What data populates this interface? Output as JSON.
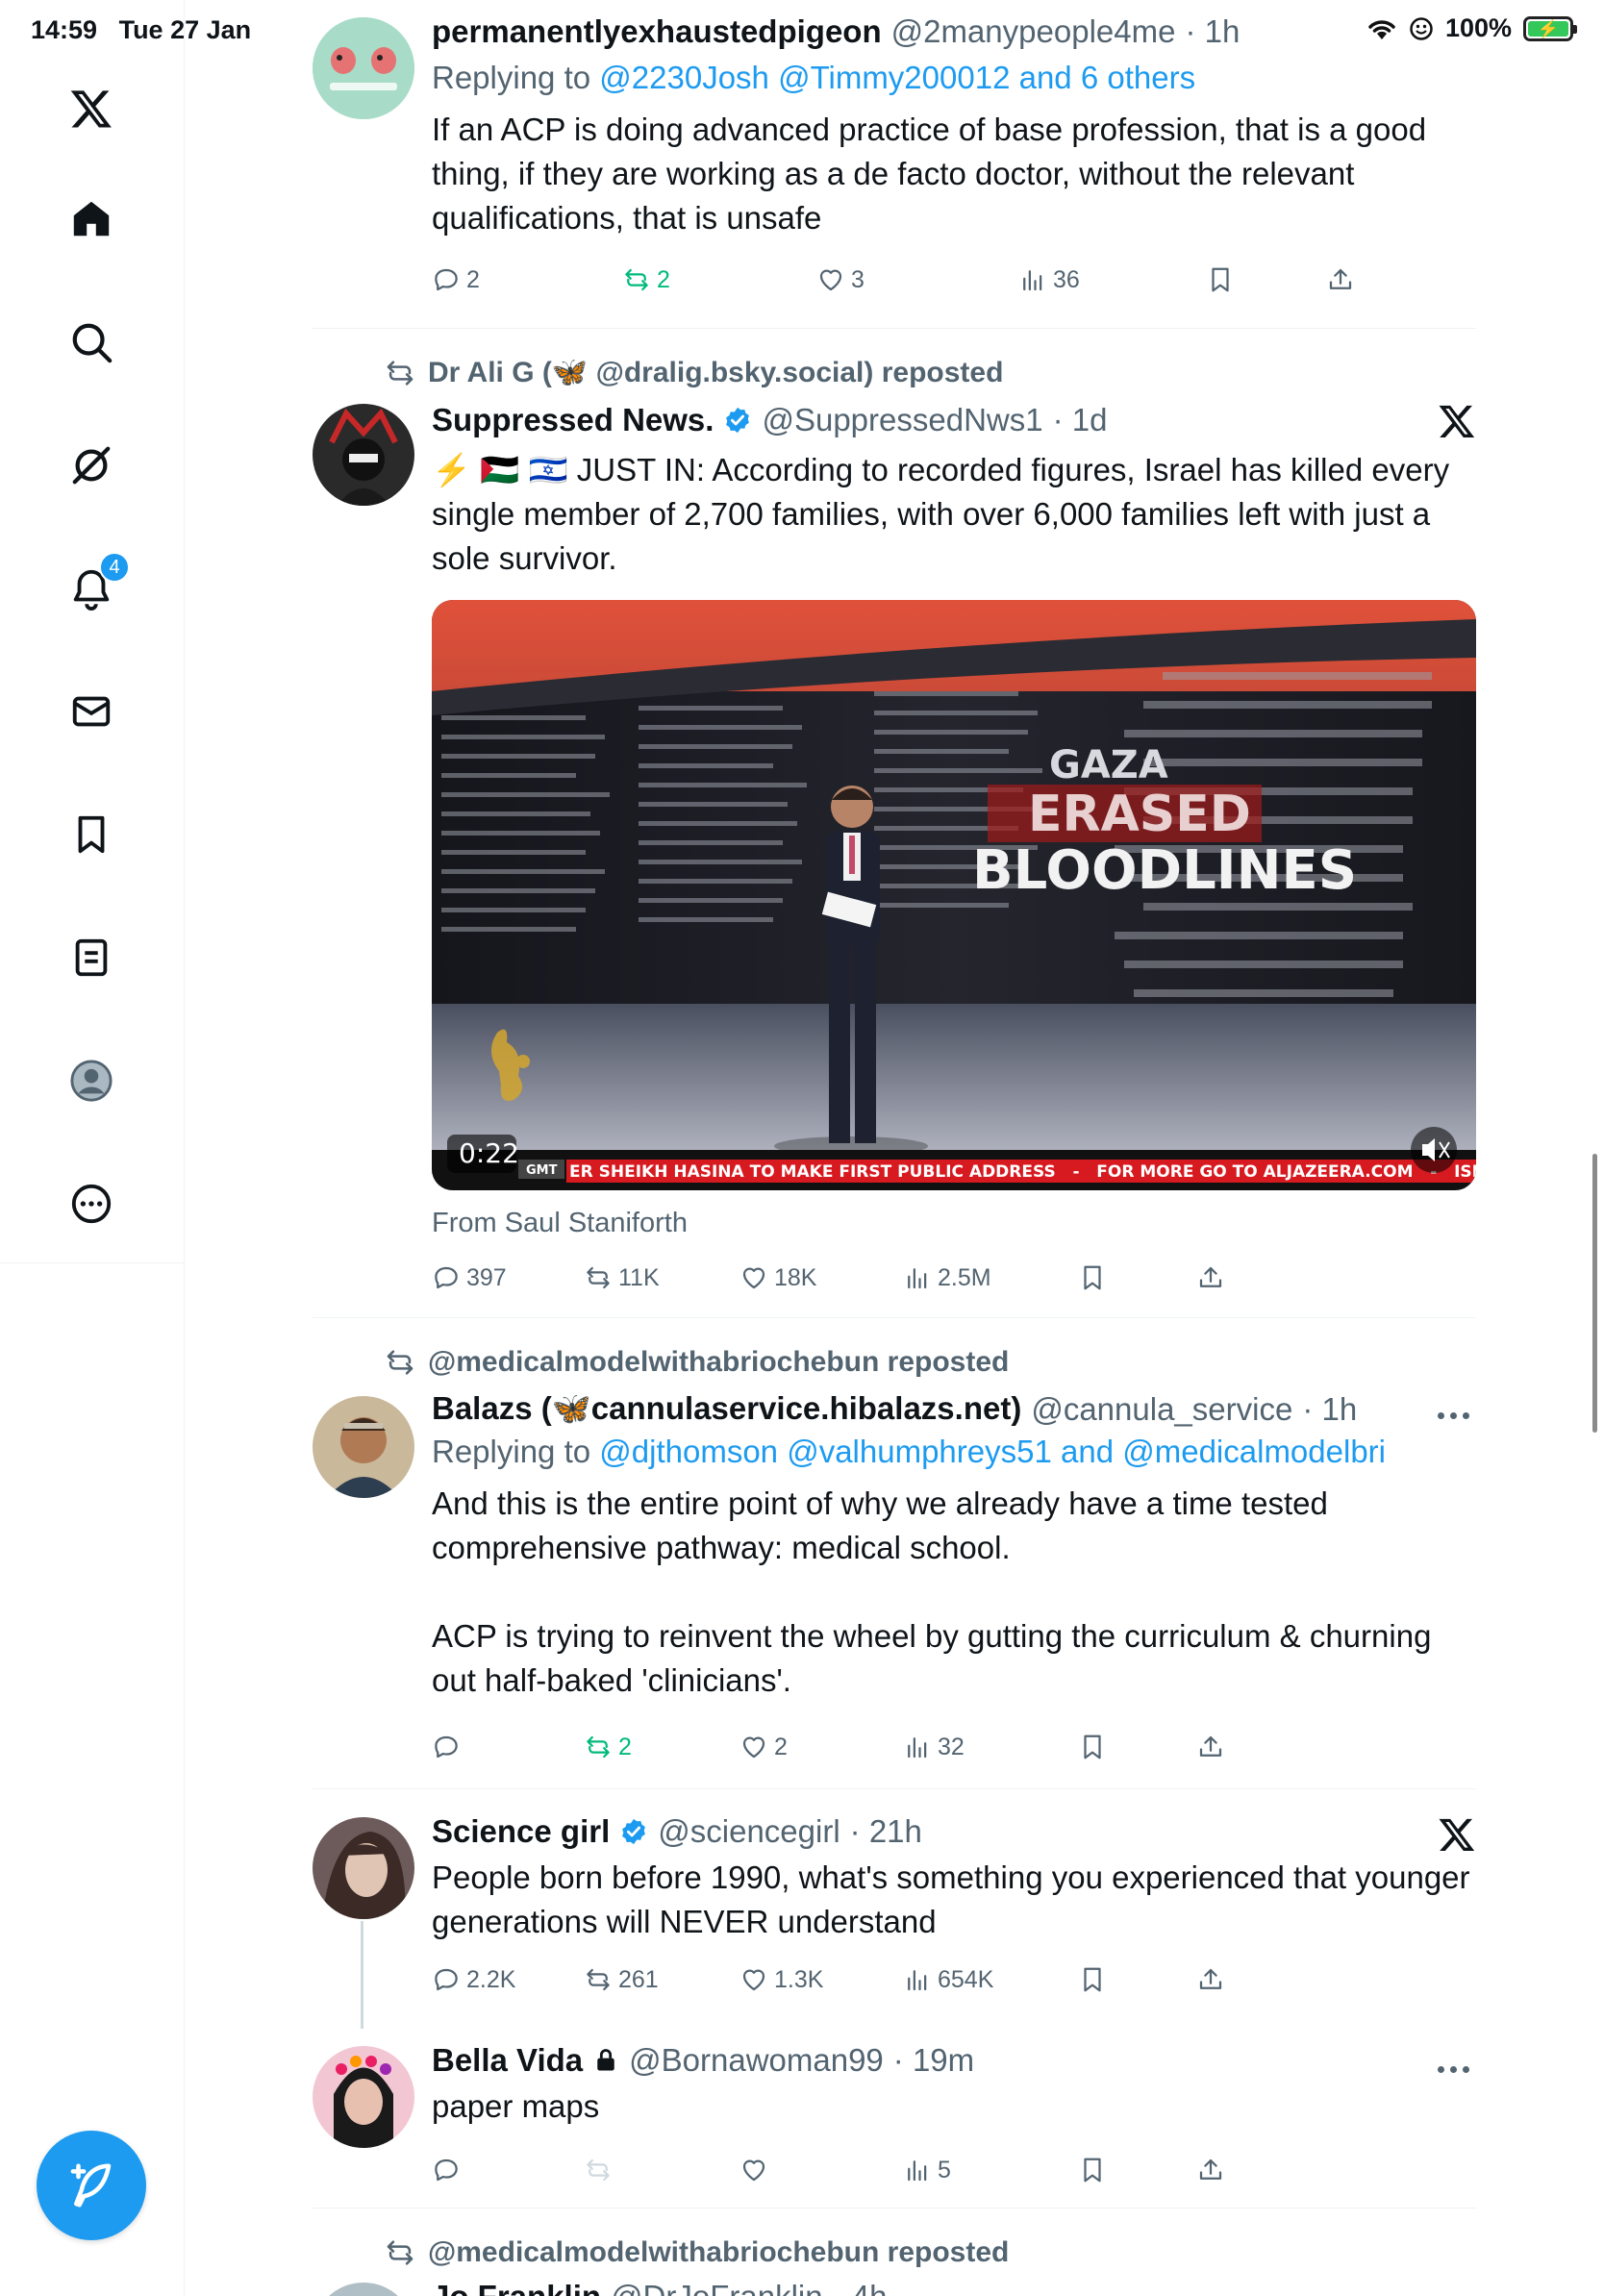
{
  "status_bar": {
    "time": "14:59",
    "date": "Tue 27 Jan",
    "battery": "100%"
  },
  "sidebar": {
    "notifications_badge": "4",
    "items": [
      "x-logo",
      "home",
      "search",
      "grok",
      "notifications",
      "messages",
      "bookmarks",
      "lists",
      "profile",
      "more"
    ]
  },
  "posts": [
    {
      "name": "permanentlyexhaustedpigeon",
      "handle": "@2manypeople4me",
      "time": "· 1h",
      "reply_prefix": "Replying to",
      "reply_targets": "@2230Josh @Timmy200012 and 6 others",
      "text": "If an ACP is doing advanced practice of base profession, that is a good thing, if they are working as a de facto doctor, without the relevant qualifications, that is unsafe",
      "replies": "2",
      "reposts": "2",
      "likes": "3",
      "views": "36"
    },
    {
      "repost_by": "Dr Ali G (🦋 @dralig.bsky.social) reposted",
      "name": "Suppressed News.",
      "handle": "@SuppressedNws1",
      "time": "· 1d",
      "text": "⚡️ 🇵🇸 🇮🇱 JUST IN: According to recorded figures, Israel has killed every single member of 2,700 families, with over 6,000 families left with just a sole survivor.",
      "video": {
        "headline_1": "GAZA",
        "headline_2": "ERASED",
        "headline_3": "BLOODLINES",
        "duration": "0:22",
        "gmt": "GMT",
        "ticker": "ER SHEIKH HASINA TO MAKE FIRST PUBLIC ADDRESS   -   FOR MORE GO TO ALJAZEERA.COM   -   ISRAEL"
      },
      "from": "From Saul Staniforth",
      "replies": "397",
      "reposts": "11K",
      "likes": "18K",
      "views": "2.5M"
    },
    {
      "repost_by": "@medicalmodelwithabriochebun reposted",
      "name": "Balazs (🦋cannulaservice.hibalazs.net)",
      "handle": "@cannula_service",
      "time": "· 1h",
      "reply_prefix": "Replying to",
      "reply_targets": "@djthomson @valhumphreys51 and @medicalmodelbri",
      "text": "And this is the entire point of why we already have a time tested comprehensive pathway: medical school.\n\nACP is trying to reinvent the wheel by gutting the curriculum & churning out half-baked 'clinicians'.",
      "replies": "",
      "reposts": "2",
      "likes": "2",
      "views": "32"
    },
    {
      "name": "Science girl",
      "handle": "@sciencegirl",
      "time": "· 21h",
      "text": "People born before 1990, what's something you experienced that younger generations will NEVER understand",
      "replies": "2.2K",
      "reposts": "261",
      "likes": "1.3K",
      "views": "654K"
    },
    {
      "name": "Bella Vida",
      "handle": "@Bornawoman99",
      "time": "· 19m",
      "text": "paper maps",
      "replies": "",
      "reposts": "",
      "likes": "",
      "views": "5"
    },
    {
      "repost_by": "@medicalmodelwithabriochebun reposted",
      "name": "Jo Franklin",
      "handle": "@DrJoFranklin",
      "time": "· 4h"
    }
  ]
}
